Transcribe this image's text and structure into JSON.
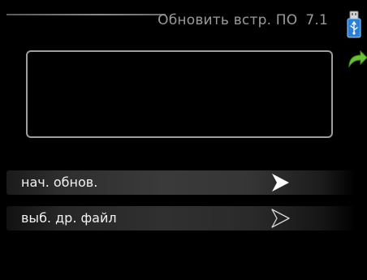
{
  "header": {
    "title": "Обновить встр. ПО",
    "menu_number": "7.1"
  },
  "icons": {
    "usb": "usb-stick-icon",
    "back": "back-arrow-icon",
    "play_filled": "play-filled-icon",
    "play_outline": "play-outline-icon"
  },
  "info": {
    "text": ""
  },
  "menu": {
    "items": [
      {
        "label": "нач. обнов.",
        "selected": true
      },
      {
        "label": "выб. др. файл",
        "selected": false
      }
    ]
  },
  "colors": {
    "background": "#000000",
    "back_arrow": "#6cbf3a",
    "usb_blue": "#2a7fd4"
  }
}
